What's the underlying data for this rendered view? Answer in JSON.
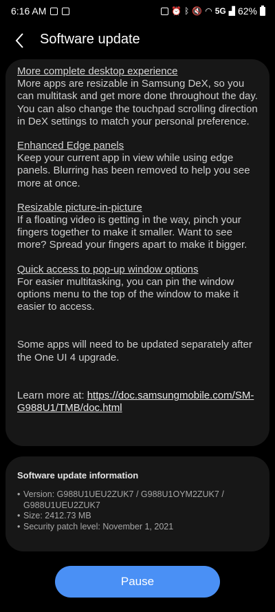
{
  "status_bar": {
    "time": "6:16 AM",
    "network": "5G",
    "battery": "62%"
  },
  "header": {
    "title": "Software update"
  },
  "features": [
    {
      "heading": "More complete desktop experience",
      "text": "More apps are resizable in Samsung DeX, so you can multitask and get more done throughout the day. You can also change the touchpad scrolling direction in DeX settings to match your personal preference."
    },
    {
      "heading": "Enhanced Edge panels",
      "text": "Keep your current app in view while using edge panels. Blurring has been removed to help you see more at once."
    },
    {
      "heading": "Resizable picture-in-picture",
      "text": "If a floating video is getting in the way, pinch your fingers together to make it smaller. Want to see more? Spread your fingers apart to make it bigger."
    },
    {
      "heading": "Quick access to pop-up window options",
      "text": "For easier multitasking, you can pin the window options menu to the top of the window to make it easier to access."
    }
  ],
  "note": "Some apps will need to be updated separately after the One UI 4 upgrade.",
  "learn_more": {
    "prefix": "Learn more at: ",
    "link": "https://doc.samsungmobile.com/SM-G988U1/TMB/doc.html"
  },
  "info": {
    "title": "Software update information",
    "version": "Version: G988U1UEU2ZUK7 / G988U1OYM2ZUK7 / G988U1UEU2ZUK7",
    "size": "Size: 2412.73 MB",
    "security_patch": "Security patch level: November 1, 2021"
  },
  "pause_label": "Pause",
  "colors": {
    "background": "#000000",
    "card": "#171717",
    "accent": "#4a90f5"
  }
}
